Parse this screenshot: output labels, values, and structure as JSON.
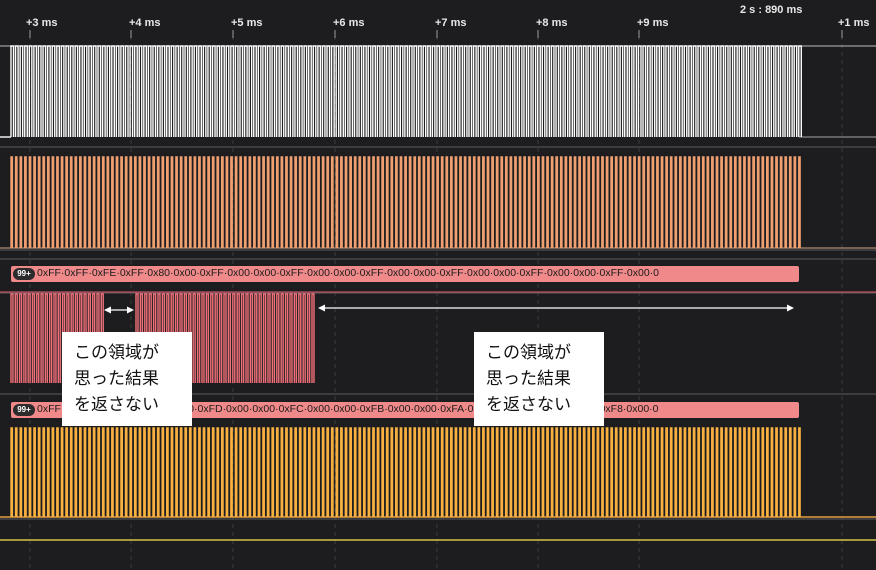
{
  "ruler": {
    "ticks": [
      "+3 ms",
      "+4 ms",
      "+5 ms",
      "+6 ms",
      "+7 ms",
      "+8 ms",
      "+9 ms",
      "+1 ms"
    ],
    "time_readout": "2 s : 890 ms"
  },
  "channels": [
    {
      "name": "channel-0",
      "color": "#ffffff"
    },
    {
      "name": "channel-1",
      "color": "#f0a070"
    },
    {
      "name": "channel-2",
      "color": "#f0707a"
    },
    {
      "name": "channel-3",
      "color": "#f8b040"
    }
  ],
  "decoders": [
    {
      "badge": "99+",
      "text": "0xFF·0xFF·0xFE·0xFF·0x80·0x00·0xFF·0x00·0x00·0xFF·0x00·0x00·0xFF·0x00·0x00·0xFF·0x00·0x00·0xFF·0x00·0x00·0xFF·0x00·0"
    },
    {
      "badge": "99+",
      "text": "0xFF·0x00·0x00·0xFE·0x00·0x00·0xFD·0x00·0x00·0xFC·0x00·0x00·0xFB·0x00·0x00·0xFA·0x00·0x00·0xF9·0x00·0x00·0xF8·0x00·0"
    }
  ],
  "callouts": [
    {
      "text": "この領域が\n思った結果\nを返さない"
    },
    {
      "text": "この領域が\n思った結果\nを返さない"
    }
  ],
  "colors": {
    "background": "#1d1d1f",
    "grid": "#3a3a3e",
    "separator": "#5a5a5e",
    "marker_yellow": "#d4c44a",
    "arrow": "#ffffff"
  }
}
